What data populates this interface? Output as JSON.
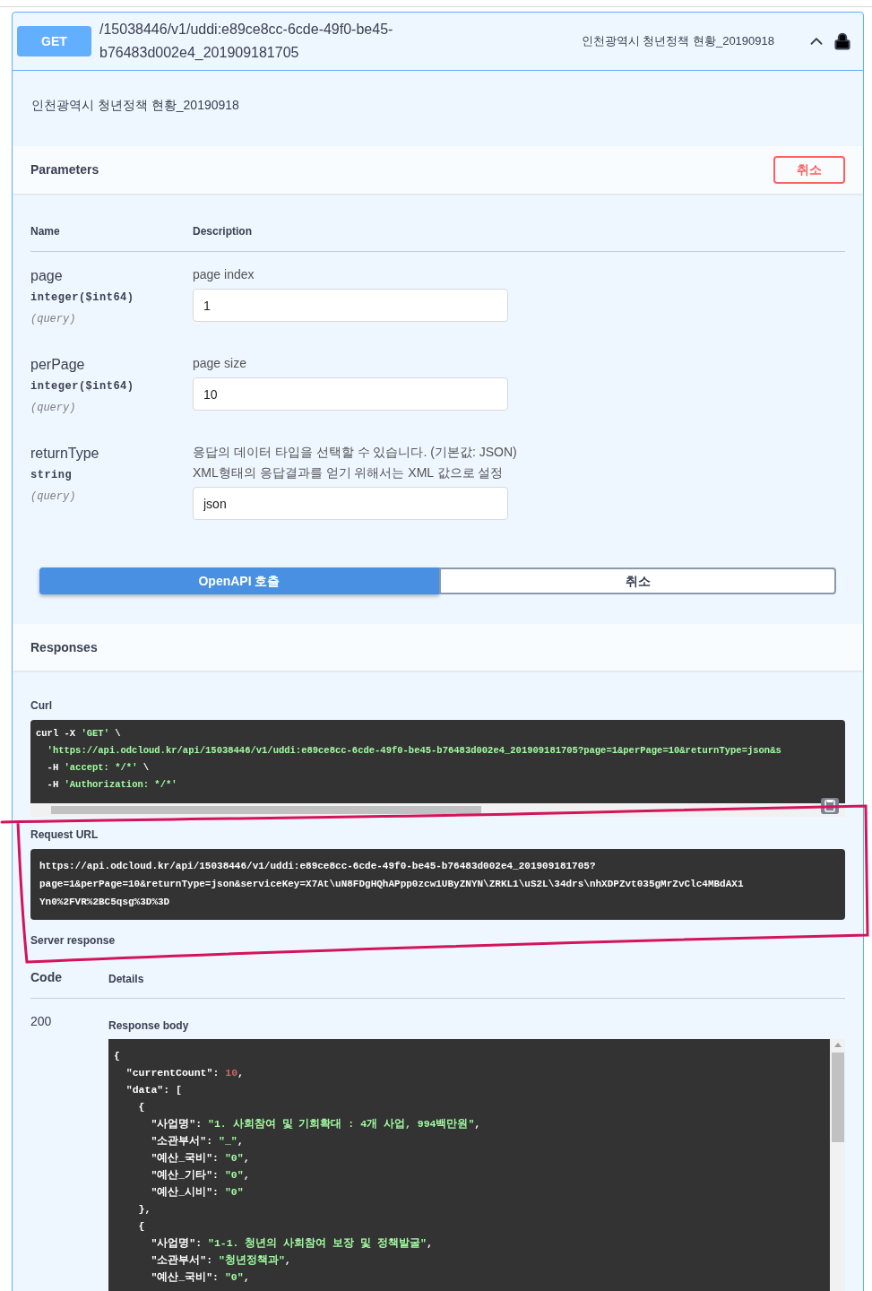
{
  "operation": {
    "method": "GET",
    "path_lines": [
      "/15038446/v1/uddi:e89ce8cc-6cde-49f0-be45-",
      "b76483d002e4_201909181705"
    ],
    "summary": "인천광역시 청년정책 현황_20190918",
    "expanded": true,
    "locked": true
  },
  "description": "인천광역시 청년정책 현황_20190918",
  "parameters": {
    "title": "Parameters",
    "cancel_button": "취소",
    "columns": [
      "Name",
      "Description"
    ],
    "rows": [
      {
        "name": "page",
        "type": "integer($int64)",
        "in": "(query)",
        "description": [
          "page index"
        ],
        "value": "1"
      },
      {
        "name": "perPage",
        "type": "integer($int64)",
        "in": "(query)",
        "description": [
          "page size"
        ],
        "value": "10"
      },
      {
        "name": "returnType",
        "type": "string",
        "in": "(query)",
        "description": [
          "응답의 데이터 타입을 선택할 수 있습니다. (기본값: JSON)",
          "XML형태의 응답결과를 얻기 위해서는 XML 값으로 설정"
        ],
        "value": "json"
      }
    ],
    "execute_button": "OpenAPI 호출",
    "clear_button": "취소"
  },
  "responses": {
    "title": "Responses",
    "curl_label": "Curl",
    "curl_lines": [
      [
        {
          "kind": "plain",
          "text": "curl -X "
        },
        {
          "kind": "string",
          "text": "'GET'"
        },
        {
          "kind": "plain",
          "text": " \\"
        }
      ],
      [
        {
          "kind": "string",
          "text": "  'https://api.odcloud.kr/api/15038446/v1/uddi:e89ce8cc-6cde-49f0-be45-b76483d002e4_201909181705?page=1&perPage=10&returnType=json&s"
        }
      ],
      [
        {
          "kind": "plain",
          "text": "  -H "
        },
        {
          "kind": "string",
          "text": "'accept: */*'"
        },
        {
          "kind": "plain",
          "text": " \\"
        }
      ],
      [
        {
          "kind": "plain",
          "text": "  -H "
        },
        {
          "kind": "string",
          "text": "'Authorization: */*'"
        }
      ]
    ],
    "request_url_label": "Request URL",
    "request_url_lines": [
      "https://api.odcloud.kr/api/15038446/v1/uddi:e89ce8cc-6cde-49f0-be45-b76483d002e4_201909181705?",
      "page=1&perPage=10&returnType=json&serviceKey=X7At\\uN8FDgHQhAPpp0zcw1UByZNYN\\ZRKL1\\uS2L\\34drs\\nhXDPZvt035gMrZvClc4MBdAX1",
      "Yn0%2FVR%2BC5qsg%3D%3D"
    ],
    "server_response_label": "Server response",
    "columns": [
      "Code",
      "Details"
    ],
    "code": "200",
    "body_label": "Response body",
    "body_lines": [
      [
        {
          "kind": "plain",
          "text": "{"
        }
      ],
      [
        {
          "kind": "plain",
          "text": "  \"currentCount\": "
        },
        {
          "kind": "number",
          "text": "10"
        },
        {
          "kind": "plain",
          "text": ","
        }
      ],
      [
        {
          "kind": "plain",
          "text": "  \"data\": ["
        }
      ],
      [
        {
          "kind": "plain",
          "text": "    {"
        }
      ],
      [
        {
          "kind": "plain",
          "text": "      \"사업명\": "
        },
        {
          "kind": "string",
          "text": "\"1. 사회참여 및 기회확대 : 4개 사업, 994백만원\""
        },
        {
          "kind": "plain",
          "text": ","
        }
      ],
      [
        {
          "kind": "plain",
          "text": "      \"소관부서\": "
        },
        {
          "kind": "string",
          "text": "\"_\""
        },
        {
          "kind": "plain",
          "text": ","
        }
      ],
      [
        {
          "kind": "plain",
          "text": "      \"예산_국비\": "
        },
        {
          "kind": "string",
          "text": "\"0\""
        },
        {
          "kind": "plain",
          "text": ","
        }
      ],
      [
        {
          "kind": "plain",
          "text": "      \"예산_기타\": "
        },
        {
          "kind": "string",
          "text": "\"0\""
        },
        {
          "kind": "plain",
          "text": ","
        }
      ],
      [
        {
          "kind": "plain",
          "text": "      \"예산_시비\": "
        },
        {
          "kind": "string",
          "text": "\"0\""
        }
      ],
      [
        {
          "kind": "plain",
          "text": "    },"
        }
      ],
      [
        {
          "kind": "plain",
          "text": "    {"
        }
      ],
      [
        {
          "kind": "plain",
          "text": "      \"사업명\": "
        },
        {
          "kind": "string",
          "text": "\"1-1. 청년의 사회참여 보장 및 정책발굴\""
        },
        {
          "kind": "plain",
          "text": ","
        }
      ],
      [
        {
          "kind": "plain",
          "text": "      \"소관부서\": "
        },
        {
          "kind": "string",
          "text": "\"청년정책과\""
        },
        {
          "kind": "plain",
          "text": ","
        }
      ],
      [
        {
          "kind": "plain",
          "text": "      \"예산_국비\": "
        },
        {
          "kind": "string",
          "text": "\"0\""
        },
        {
          "kind": "plain",
          "text": ","
        }
      ]
    ]
  }
}
